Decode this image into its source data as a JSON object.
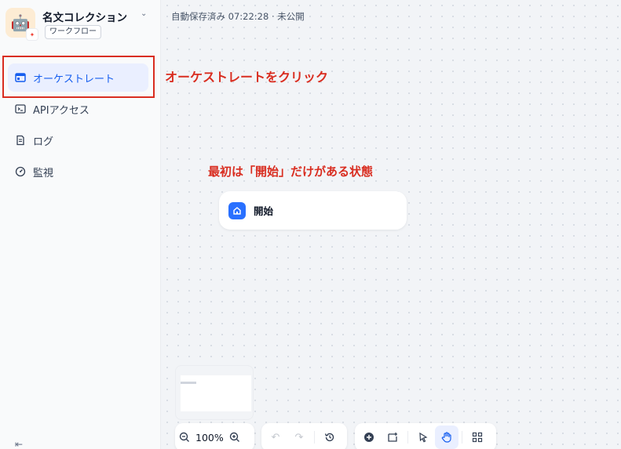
{
  "app": {
    "name": "名文コレクション",
    "type_badge": "ワークフロー"
  },
  "sidebar": {
    "items": [
      {
        "label": "オーケストレート",
        "icon": "window-icon",
        "active": true
      },
      {
        "label": "APIアクセス",
        "icon": "terminal-icon",
        "active": false
      },
      {
        "label": "ログ",
        "icon": "document-list-icon",
        "active": false
      },
      {
        "label": "監視",
        "icon": "gauge-icon",
        "active": false
      }
    ]
  },
  "status": {
    "text": "自動保存済み 07:22:28 · 未公開"
  },
  "annotations": {
    "click_orchestrate": "オーケストレートをクリック",
    "start_only": "最初は「開始」だけがある状態"
  },
  "canvas": {
    "start_node_label": "開始"
  },
  "toolbar": {
    "zoom_level": "100%"
  },
  "colors": {
    "accent": "#155eef",
    "annotation": "#d92d20",
    "start_node_icon": "#2970ff"
  }
}
